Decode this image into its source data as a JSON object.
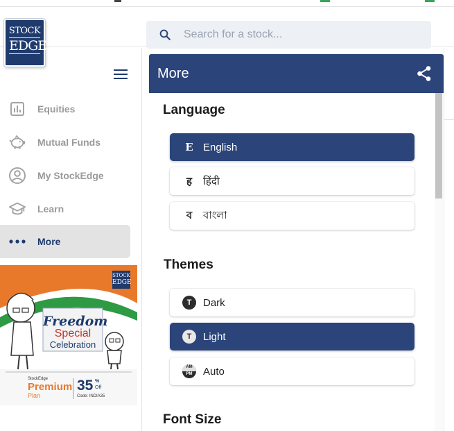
{
  "header": {
    "logo": {
      "line1": "STOCK",
      "line2": "EDGE"
    },
    "search": {
      "placeholder": "Search for a stock..."
    }
  },
  "sidebar": {
    "items": [
      {
        "label": "Equities",
        "icon": "bar-chart-icon"
      },
      {
        "label": "Mutual Funds",
        "icon": "piggy-bank-icon"
      },
      {
        "label": "My StockEdge",
        "icon": "user-circle-icon"
      },
      {
        "label": "Learn",
        "icon": "graduation-cap-icon"
      },
      {
        "label": "More",
        "icon": "more-dots-icon",
        "active": true
      }
    ],
    "banner": {
      "logo_line1": "STOCK",
      "logo_line2": "EDGE",
      "line1": "Freedom",
      "line2": "Special",
      "line3": "Celebration",
      "brand": "StockEdge",
      "premium": "Premium",
      "plan": "Plan",
      "discount": "35",
      "pct": "%",
      "off": "Off",
      "code": "Code: INDIA35"
    }
  },
  "panel": {
    "title": "More",
    "language": {
      "title": "Language",
      "options": [
        {
          "glyph": "E",
          "label": "English",
          "selected": true
        },
        {
          "glyph": "ह",
          "label": "हिंदी",
          "selected": false
        },
        {
          "glyph": "ব",
          "label": "বাংলা",
          "selected": false
        }
      ]
    },
    "themes": {
      "title": "Themes",
      "options": [
        {
          "glyph": "T",
          "label": "Dark",
          "selected": false
        },
        {
          "glyph": "T",
          "label": "Light",
          "selected": true
        },
        {
          "am": "AM",
          "pm": "PM",
          "label": "Auto",
          "selected": false
        }
      ]
    },
    "font_size": {
      "title": "Font Size"
    }
  },
  "colors": {
    "primary": "#2b4479",
    "logo_bg": "#1f3a6d",
    "sidebar_active_bg": "#e3e3e3",
    "muted_text": "#9a9a9a",
    "banner_orange": "#e8792b",
    "banner_green": "#2e9a43"
  }
}
